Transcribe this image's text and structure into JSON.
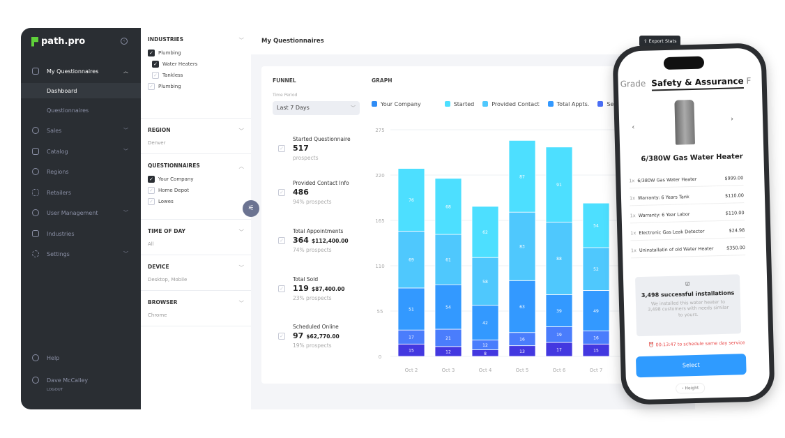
{
  "sidebar": {
    "brand": "path.pro",
    "items": [
      {
        "label": "My Questionnaires",
        "icon": "clipboard-icon"
      },
      {
        "label": "Dashboard"
      },
      {
        "label": "Questionnaires"
      },
      {
        "label": "Sales",
        "icon": "user-circle-icon"
      },
      {
        "label": "Catalog",
        "icon": "box-icon"
      },
      {
        "label": "Regions",
        "icon": "map-pin-icon"
      },
      {
        "label": "Retailers",
        "icon": "grid-icon"
      },
      {
        "label": "User Management",
        "icon": "user-circle-icon"
      },
      {
        "label": "Industries",
        "icon": "briefcase-icon"
      },
      {
        "label": "Settings",
        "icon": "gear-icon"
      }
    ],
    "help": "Help",
    "user": "Dave McCalley",
    "logout": "LOGOUT"
  },
  "filters": {
    "industries": {
      "title": "INDUSTRIES",
      "items": [
        {
          "label": "Plumbing",
          "checked": true
        },
        {
          "label": "Water Heaters",
          "checked": true
        },
        {
          "label": "Tankless",
          "checked": false
        },
        {
          "label": "Plumbing",
          "checked": false
        }
      ]
    },
    "region": {
      "title": "REGION",
      "value": "Denver"
    },
    "questionnaires": {
      "title": "QUESTIONNAIRES",
      "items": [
        {
          "label": "Your Company",
          "checked": true
        },
        {
          "label": "Home Depot",
          "checked": false
        },
        {
          "label": "Lowes",
          "checked": false
        }
      ]
    },
    "time": {
      "title": "TIME OF DAY",
      "value": "All"
    },
    "device": {
      "title": "DEVICE",
      "value": "Desktop, Mobile"
    },
    "browser": {
      "title": "BROWSER",
      "value": "Chrome"
    }
  },
  "header": {
    "title": "My Questionnaires",
    "export": "Export Stats"
  },
  "funnel": {
    "title": "FUNNEL",
    "time_label": "Time Period",
    "time_value": "Last 7 Days",
    "metrics": [
      {
        "title": "Started Questionnaire",
        "value": "517",
        "amount": "",
        "sub": "prospects"
      },
      {
        "title": "Provided Contact Info",
        "value": "486",
        "amount": "",
        "sub": "94% prospects"
      },
      {
        "title": "Total Appointments",
        "value": "364",
        "amount": "$112,400.00",
        "sub": "74% prospects"
      },
      {
        "title": "Total Sold",
        "value": "119",
        "amount": "$87,400.00",
        "sub": "23% prospects"
      },
      {
        "title": "Scheduled Online",
        "value": "97",
        "amount": "$62,770.00",
        "sub": "19% prospects"
      }
    ]
  },
  "graph": {
    "title": "GRAPH",
    "legend": [
      {
        "label": "Your Company",
        "color": "#2f8cf5"
      },
      {
        "label": "Started",
        "color": "#4ddfff"
      },
      {
        "label": "Provided Contact",
        "color": "#4fc8fd"
      },
      {
        "label": "Total Appts.",
        "color": "#3399ff"
      },
      {
        "label": "Se",
        "color": "#4a6ef5"
      }
    ]
  },
  "chart_data": {
    "type": "bar",
    "stacked": true,
    "categories": [
      "Oct 2",
      "Oct 3",
      "Oct 4",
      "Oct 5",
      "Oct 6",
      "Oct 7"
    ],
    "yticks": [
      0,
      55,
      110,
      165,
      220,
      275
    ],
    "ylim": [
      0,
      275
    ],
    "grid": true,
    "series": [
      {
        "color": "#4338e0",
        "values": [
          15,
          12,
          8,
          13,
          17,
          15
        ]
      },
      {
        "color": "#4a7dfc",
        "values": [
          17,
          21,
          12,
          16,
          19,
          16
        ]
      },
      {
        "name": "Total Appts.",
        "color": "#3399ff",
        "values": [
          51,
          54,
          42,
          63,
          39,
          49
        ]
      },
      {
        "name": "Provided Contact",
        "color": "#4fc8fd",
        "values": [
          69,
          61,
          58,
          83,
          88,
          52
        ]
      },
      {
        "name": "Started",
        "color": "#4ddfff",
        "values": [
          76,
          68,
          62,
          87,
          91,
          54
        ]
      }
    ]
  },
  "phone": {
    "tab_prev": "Grade",
    "tab_active": "Safety & Assurance",
    "tab_next": "F",
    "product": "6/380W Gas Water Heater",
    "items": [
      {
        "qty": "1x",
        "name": "6/380W Gas Water Heater",
        "price": "$999.00"
      },
      {
        "qty": "1x",
        "name": "Warranty: 6 Years Tank",
        "price": "$110.00"
      },
      {
        "qty": "1x",
        "name": "Warranty: 6 Year Labor",
        "price": "$110.00"
      },
      {
        "qty": "1x",
        "name": "Electronic Gas Leak Detector",
        "price": "$24.98"
      },
      {
        "qty": "1x",
        "name": "Uninstallatin of old Water Heater",
        "price": "$350.00"
      }
    ],
    "installs_title": "3,498 successful installations",
    "installs_text": "We installed this water heater to 3,498 customers with needs similar to yours.",
    "timer": "00:13:47 to schedule same day service",
    "select": "Select",
    "height": "Height"
  }
}
